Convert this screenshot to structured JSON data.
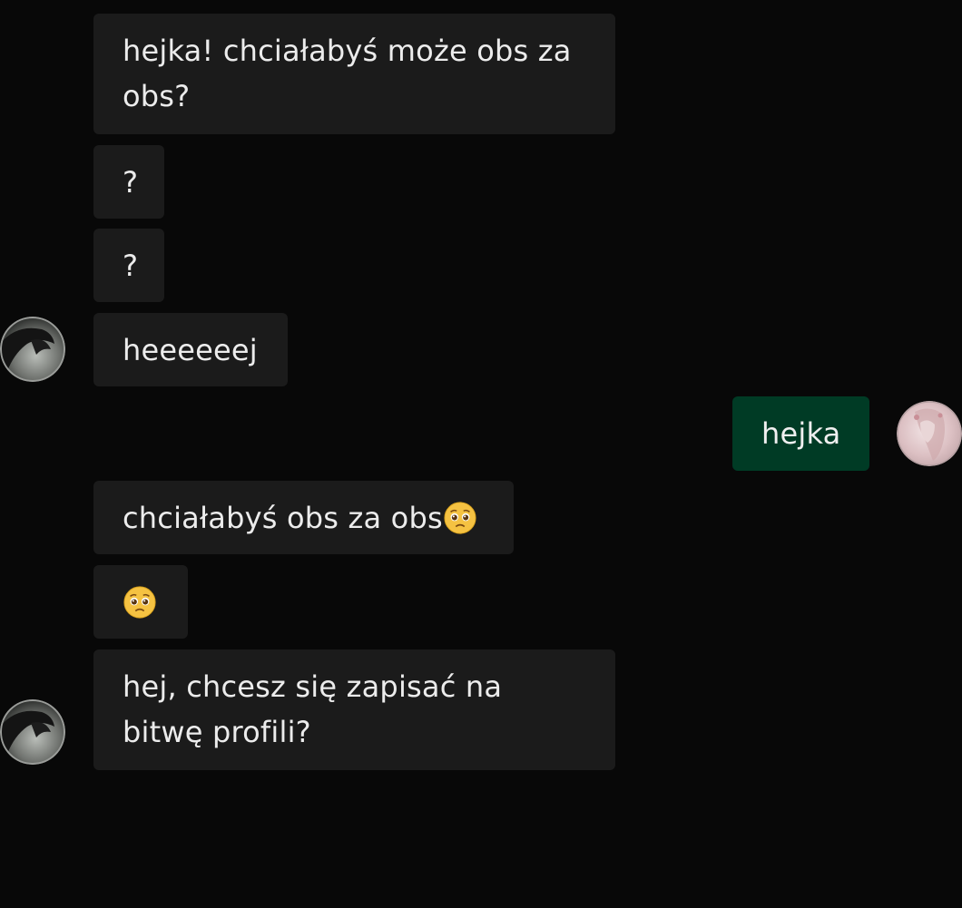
{
  "chat": {
    "messages": [
      {
        "text": "hejka! chciałabyś może obs za obs?"
      },
      {
        "text": "?"
      },
      {
        "text": "?"
      },
      {
        "text": "heeeeeej"
      },
      {
        "text": "hejka"
      },
      {
        "text": "chciałabyś obs za obs"
      },
      {
        "text": ""
      },
      {
        "text": "hej, chcesz się zapisać na bitwę profili?"
      }
    ],
    "colors": {
      "background": "#080808",
      "incoming_bubble": "#1b1b1b",
      "outgoing_bubble": "#003b25",
      "text": "#ececec"
    },
    "icons": {
      "pleading_emoji": "pleading-face-emoji"
    }
  }
}
